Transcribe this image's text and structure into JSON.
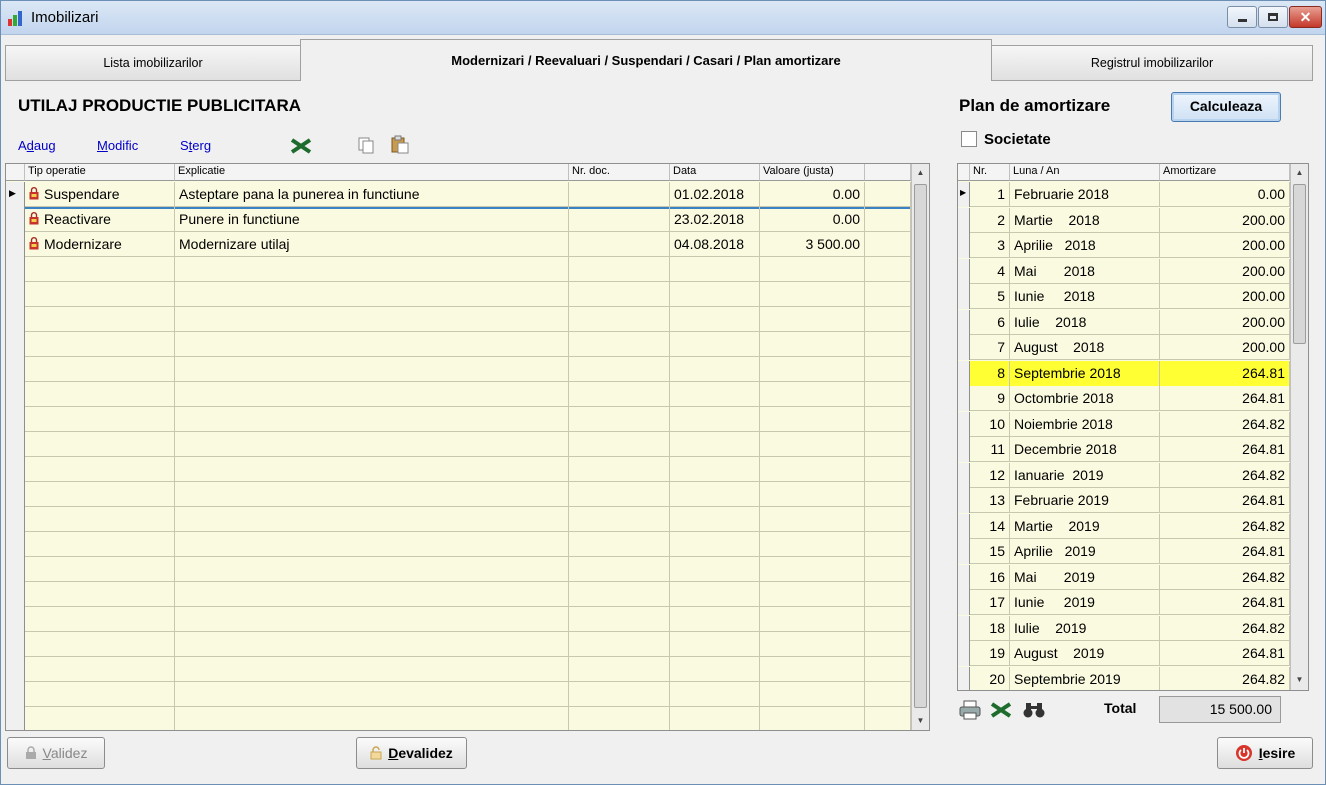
{
  "window": {
    "title": "Imobilizari"
  },
  "tabs": {
    "lista": "Lista imobilizarilor",
    "modernizari": "Modernizari / Reevaluari / Suspendari / Casari / Plan amortizare",
    "registru": "Registrul imobilizarilor"
  },
  "asset": {
    "name": "UTILAJ PRODUCTIE PUBLICITARA"
  },
  "actions": {
    "add": "Adaug",
    "add_key": "d",
    "modify": "Modific",
    "modify_key": "M",
    "delete": "Sterg",
    "delete_key": "t"
  },
  "operations": {
    "columns": [
      "Tip operatie",
      "Explicatie",
      "Nr. doc.",
      "Data",
      "Valoare (justa)"
    ],
    "rows": [
      {
        "type": "Suspendare",
        "explanation": "Asteptare pana la punerea in functiune",
        "doc": "",
        "date": "01.02.2018",
        "value": "0.00"
      },
      {
        "type": "Reactivare",
        "explanation": "Punere in functiune",
        "doc": "",
        "date": "23.02.2018",
        "value": "0.00"
      },
      {
        "type": "Modernizare",
        "explanation": "Modernizare utilaj",
        "doc": "",
        "date": "04.08.2018",
        "value": "3 500.00"
      }
    ]
  },
  "plan": {
    "title": "Plan de amortizare",
    "calc_button": "Calculeaza",
    "company_label": "Societate",
    "columns": [
      "Nr.",
      "Luna / An",
      "Amortizare"
    ],
    "rows": [
      {
        "nr": "1",
        "month": "Februarie 2018",
        "amount": "0.00"
      },
      {
        "nr": "2",
        "month": "Martie    2018",
        "amount": "200.00"
      },
      {
        "nr": "3",
        "month": "Aprilie   2018",
        "amount": "200.00"
      },
      {
        "nr": "4",
        "month": "Mai       2018",
        "amount": "200.00"
      },
      {
        "nr": "5",
        "month": "Iunie     2018",
        "amount": "200.00"
      },
      {
        "nr": "6",
        "month": "Iulie    2018",
        "amount": "200.00"
      },
      {
        "nr": "7",
        "month": "August    2018",
        "amount": "200.00"
      },
      {
        "nr": "8",
        "month": "Septembrie 2018",
        "amount": "264.81"
      },
      {
        "nr": "9",
        "month": "Octombrie 2018",
        "amount": "264.81"
      },
      {
        "nr": "10",
        "month": "Noiembrie 2018",
        "amount": "264.82"
      },
      {
        "nr": "11",
        "month": "Decembrie 2018",
        "amount": "264.81"
      },
      {
        "nr": "12",
        "month": "Ianuarie  2019",
        "amount": "264.82"
      },
      {
        "nr": "13",
        "month": "Februarie 2019",
        "amount": "264.81"
      },
      {
        "nr": "14",
        "month": "Martie    2019",
        "amount": "264.82"
      },
      {
        "nr": "15",
        "month": "Aprilie   2019",
        "amount": "264.81"
      },
      {
        "nr": "16",
        "month": "Mai       2019",
        "amount": "264.82"
      },
      {
        "nr": "17",
        "month": "Iunie     2019",
        "amount": "264.81"
      },
      {
        "nr": "18",
        "month": "Iulie    2019",
        "amount": "264.82"
      },
      {
        "nr": "19",
        "month": "August    2019",
        "amount": "264.81"
      },
      {
        "nr": "20",
        "month": "Septembrie 2019",
        "amount": "264.82"
      }
    ],
    "total_label": "Total",
    "total_value": "15 500.00"
  },
  "footer": {
    "validate": "Validez",
    "validate_key": "V",
    "devalidate": "Devalidez",
    "devalidate_key": "D",
    "exit": "Iesire",
    "exit_key": "I"
  },
  "colors": {
    "grid_bg": "#fafae0",
    "highlight": "#ffff33",
    "link": "#0000c8"
  }
}
